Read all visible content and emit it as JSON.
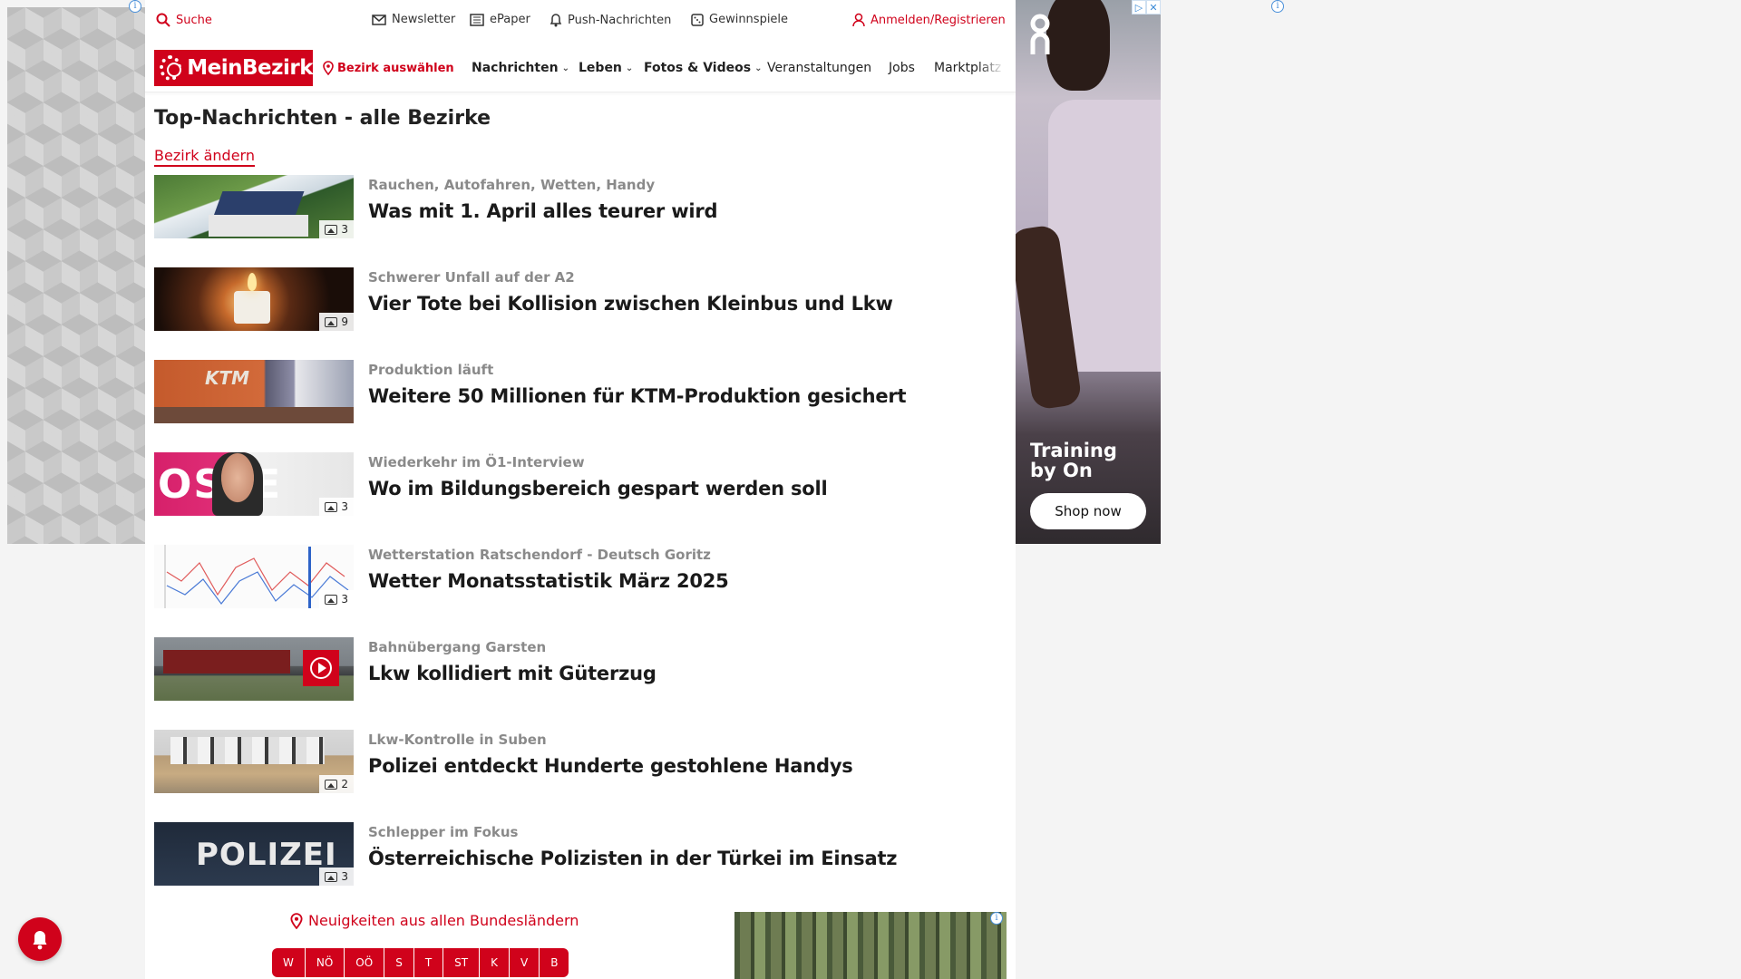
{
  "topbar": {
    "search": "Suche",
    "newsletter": "Newsletter",
    "epaper": "ePaper",
    "push": "Push-Nachrichten",
    "gewinnspiele": "Gewinnspiele",
    "login": "Anmelden/Registrieren"
  },
  "nav": {
    "logo": "MeinBezirk",
    "district": "Bezirk auswählen",
    "items": [
      "Nachrichten",
      "Leben",
      "Fotos & Videos",
      "Veranstaltungen",
      "Jobs",
      "Marktplatz"
    ]
  },
  "page": {
    "title": "Top-Nachrichten - alle Bezirke",
    "change_district": "Bezirk ändern"
  },
  "news": [
    {
      "kicker": "Rauchen, Autofahren, Wetten, Handy",
      "headline": "Was mit 1. April alles teurer wird",
      "count": "3"
    },
    {
      "kicker": "Schwerer Unfall auf der A2",
      "headline": "Vier Tote bei Kollision zwischen Kleinbus und Lkw",
      "count": "9"
    },
    {
      "kicker": "Produktion läuft",
      "headline": "Weitere 50 Millionen für KTM-Produktion gesichert",
      "count": ""
    },
    {
      "kicker": "Wiederkehr im Ö1-Interview",
      "headline": "Wo im Bildungsbereich gespart werden soll",
      "count": "3"
    },
    {
      "kicker": "Wetterstation Ratschendorf - Deutsch Goritz",
      "headline": "Wetter Monatsstatistik März 2025",
      "count": "3"
    },
    {
      "kicker": "Bahnübergang Garsten",
      "headline": "Lkw kollidiert mit Güterzug",
      "count": ""
    },
    {
      "kicker": "Lkw-Kontrolle in Suben",
      "headline": "Polizei entdeckt Hunderte gestohlene Handys",
      "count": "2"
    },
    {
      "kicker": "Schlepper im Fokus",
      "headline": "Österreichische Polizisten in der Türkei im Einsatz",
      "count": "3"
    }
  ],
  "thumb_texts": {
    "ktm": "KTM",
    "oe1": "OSTE",
    "police": "POLIZEI"
  },
  "bundeslaender": {
    "label": "Neuigkeiten aus allen Bundesländern",
    "states": [
      "W",
      "NÖ",
      "OÖ",
      "S",
      "T",
      "ST",
      "K",
      "V",
      "B"
    ]
  },
  "ad_right": {
    "brand": "On",
    "headline_line1": "Training",
    "headline_line2": "by On",
    "cta": "Shop now"
  },
  "colors": {
    "accent": "#d0021b"
  }
}
